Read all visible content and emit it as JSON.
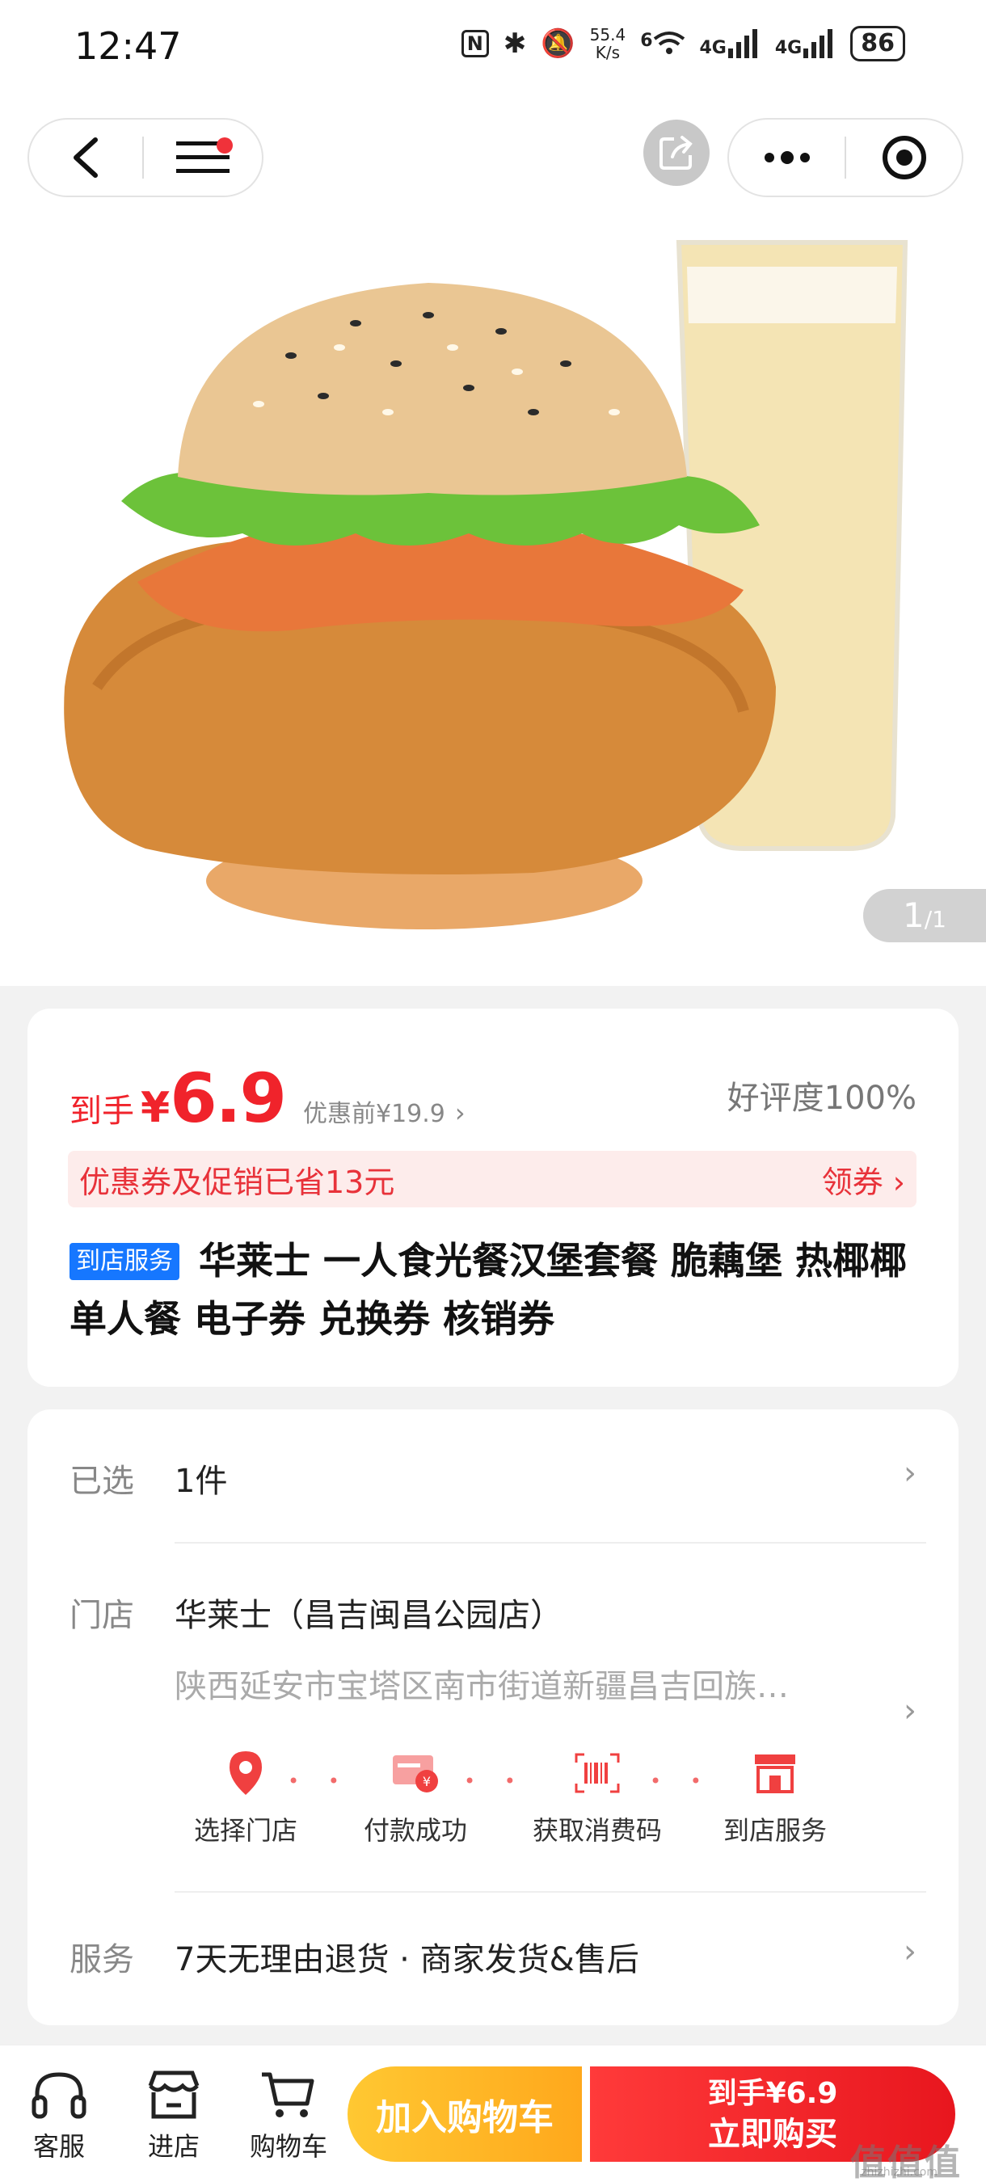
{
  "status_bar": {
    "time": "12:47",
    "nfc": "N",
    "speed_value": "55.4",
    "speed_unit": "K/s",
    "wifi_num": "6",
    "net1": "4G",
    "net2": "4G",
    "battery": "86"
  },
  "gallery": {
    "current_page": "1",
    "total_pages": "/1"
  },
  "price": {
    "prefix": "到手",
    "yen": "¥",
    "value": "6.9",
    "original": "优惠前¥19.9",
    "original_arrow": "›",
    "rating": "好评度100%"
  },
  "coupon": {
    "text": "优惠券及促销已省13元",
    "action": "领券 ›"
  },
  "product": {
    "tag": "到店服务",
    "title": "华莱士 一人食光餐汉堡套餐 脆藕堡 热椰椰 单人餐 电子券 兑换券 核销券"
  },
  "details": {
    "selected_label": "已选",
    "selected_value": "1件",
    "store_label": "门店",
    "store_name": "华莱士（昌吉闽昌公园店）",
    "store_address": "陕西延安市宝塔区南市街道新疆昌吉回族…",
    "steps": [
      "选择门店",
      "付款成功",
      "获取消费码",
      "到店服务"
    ],
    "step_dots": "• •",
    "service_label": "服务",
    "service_value": "7天无理由退货 · 商家发货&售后",
    "chevron": "›"
  },
  "bottom_bar": {
    "tabs": [
      "客服",
      "进店",
      "购物车"
    ],
    "add_cart": "加入购物车",
    "buy_line1": "到手¥6.9",
    "buy_line2": "立即购买"
  },
  "watermark": {
    "text": "值值值",
    "sub": "zhizhizhi.com"
  },
  "colors": {
    "accent": "#f0232b",
    "cart_button": "#ffb423",
    "tag_blue": "#1677ff"
  }
}
